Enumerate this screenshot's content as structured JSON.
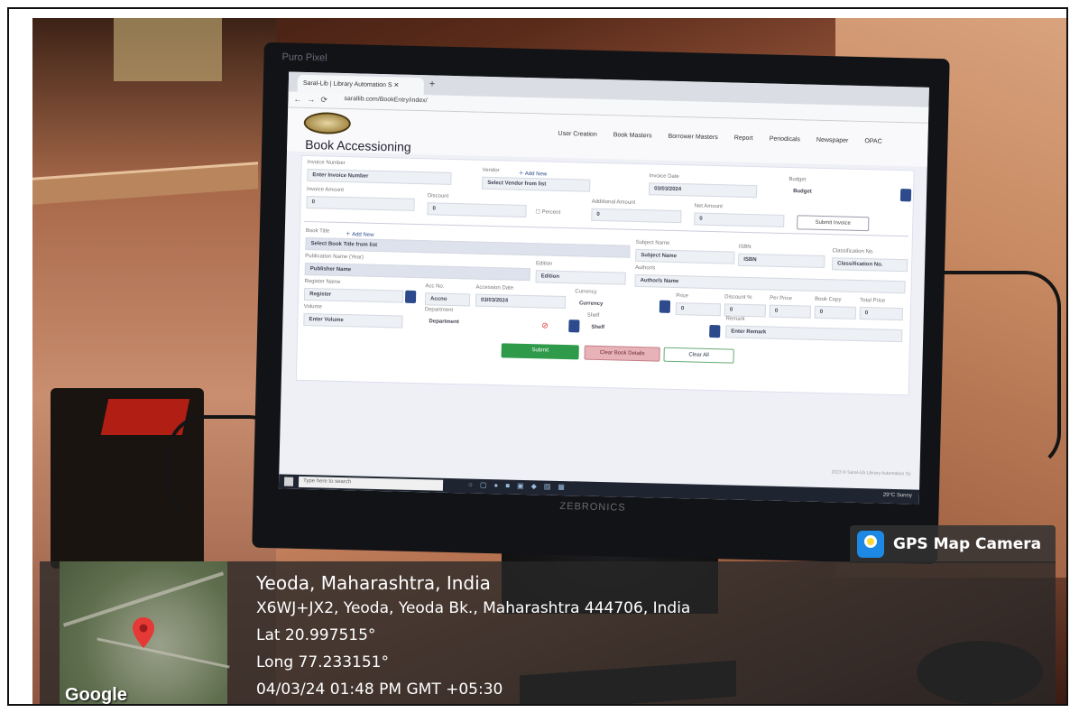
{
  "monitor": {
    "brand": "Puro Pixel",
    "bottom_brand": "ZEBRONICS"
  },
  "browser": {
    "tab_title": "Saral-Lib | Library Automation S",
    "url": "sarallib.com/BookEntry/index/"
  },
  "app": {
    "menu": [
      "User Creation",
      "Book Masters",
      "Borrower Masters",
      "Report",
      "Periodicals",
      "Newspaper",
      "OPAC"
    ],
    "page_title": "Book Accessioning",
    "invoice": {
      "invoice_number_label": "Invoice Number",
      "invoice_number_value": "Enter Invoice Number",
      "vendor_label": "Vendor",
      "add_new": "Add New",
      "vendor_value": "Select Vendor from list",
      "invoice_date_label": "Invoice Date",
      "invoice_date_value": "03/03/2024",
      "budget_label": "Budget",
      "budget_value": "Budget",
      "invoice_amount_label": "Invoice Amount",
      "invoice_amount_value": "0",
      "discount_label": "Discount",
      "discount_value": "0",
      "percent_label": "Percent",
      "additional_amount_label": "Additional Amount",
      "additional_amount_value": "0",
      "net_amount_label": "Net Amount",
      "net_amount_value": "0",
      "submit_invoice": "Submit Invoice"
    },
    "book": {
      "book_title_label": "Book Title",
      "add_new": "Add New",
      "book_title_value": "Select Book Title from list",
      "subject_name_label": "Subject Name",
      "subject_name_value": "Subject Name",
      "isbn_label": "ISBN",
      "isbn_value": "ISBN",
      "classification_label": "Classification No.",
      "classification_value": "Classification No.",
      "publication_label": "Publication Name (Year)",
      "publication_value": "Publisher Name",
      "edition_label": "Edition",
      "edition_value": "Edition",
      "authors_label": "Author/s",
      "authors_value": "Author/s Name",
      "register_label": "Register Name",
      "register_value": "Register",
      "acc_no_label": "Acc No.",
      "acc_no_value": "Accno",
      "accession_date_label": "Accession Date",
      "accession_date_value": "03/03/2024",
      "currency_label": "Currency",
      "currency_value": "Currency",
      "price_label": "Price",
      "price_value": "0",
      "discount_label": "Discount %",
      "discount_value": "0",
      "per_price_label": "Per Price",
      "per_price_value": "0",
      "book_copy_label": "Book Copy",
      "book_copy_value": "0",
      "total_price_label": "Total Price",
      "total_price_value": "0",
      "volume_label": "Volume",
      "volume_value": "Enter Volume",
      "department_label": "Department",
      "department_value": "Department",
      "shelf_label": "Shelf",
      "shelf_value": "Shelf",
      "remark_label": "Remark",
      "remark_value": "Enter Remark"
    },
    "buttons": {
      "submit": "Submit",
      "clear_book": "Clear Book Details",
      "clear_all": "Clear All"
    },
    "footer": "2023 © Saral-Lib Library Automation Sy"
  },
  "taskbar": {
    "search_placeholder": "Type here to search",
    "tray": "29°C Sunny"
  },
  "gps": {
    "badge": "GPS Map Camera",
    "place": "Yeoda, Maharashtra, India",
    "address": "X6WJ+JX2, Yeoda, Yeoda Bk., Maharashtra 444706, India",
    "lat": "Lat 20.997515°",
    "long": "Long 77.233151°",
    "datetime": "04/03/24 01:48 PM GMT +05:30",
    "map_brand": "Google"
  },
  "colors": {
    "submit_green": "#2e9a4a",
    "clear_pink": "#e7b3b8",
    "select_blue": "#2c4a8c",
    "marker_red": "#e53935"
  }
}
